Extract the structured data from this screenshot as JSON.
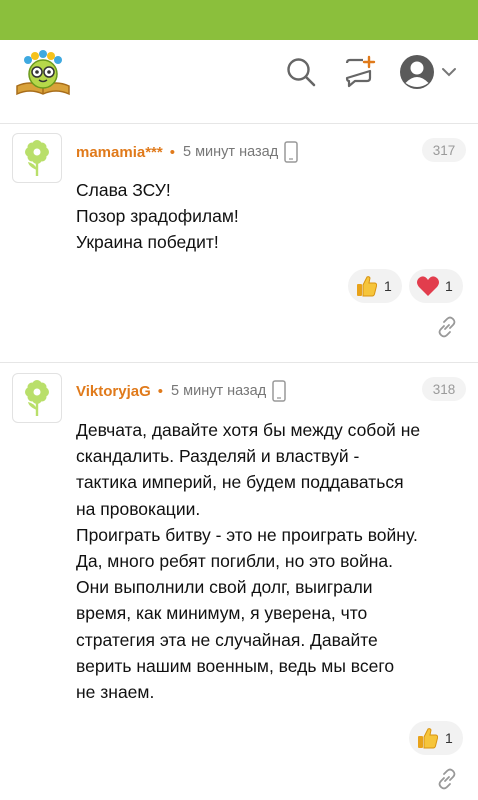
{
  "app": {
    "accent": "#8bbf3c",
    "username_color": "#e07a1b"
  },
  "header": {
    "logo_icon": "kid-book-logo",
    "icons": [
      "search-icon",
      "new-post-icon",
      "profile-icon",
      "chevron-down-icon"
    ]
  },
  "comments": [
    {
      "username": "mamamia***",
      "separator": "•",
      "time": "5 минут назад",
      "device_icon": "phone-icon",
      "number": "317",
      "lines": [
        "Слава ЗСУ!",
        "Позор зрадофилам!",
        "Украина победит!"
      ],
      "reactions": [
        {
          "icon": "thumbs-up-icon",
          "count": "1"
        },
        {
          "icon": "heart-icon",
          "count": "1"
        }
      ]
    },
    {
      "username": "ViktoryjaG",
      "separator": "•",
      "time": "5 минут назад",
      "device_icon": "phone-icon",
      "number": "318",
      "lines": [
        "Девчата, давайте хотя бы между собой не",
        "скандалить. Разделяй и властвуй -",
        "тактика империй, не будем поддаваться",
        "на провокации.",
        "Проиграть битву - это не проиграть войну.",
        "Да, много ребят погибли, но это война.",
        "Они выполнили свой долг, выиграли",
        "время, как минимум, я уверена, что",
        "стратегия эта не случайная. Давайте",
        "верить нашим военным, ведь мы всего",
        "не знаем."
      ],
      "reactions": [
        {
          "icon": "thumbs-up-icon",
          "count": "1"
        }
      ]
    }
  ]
}
